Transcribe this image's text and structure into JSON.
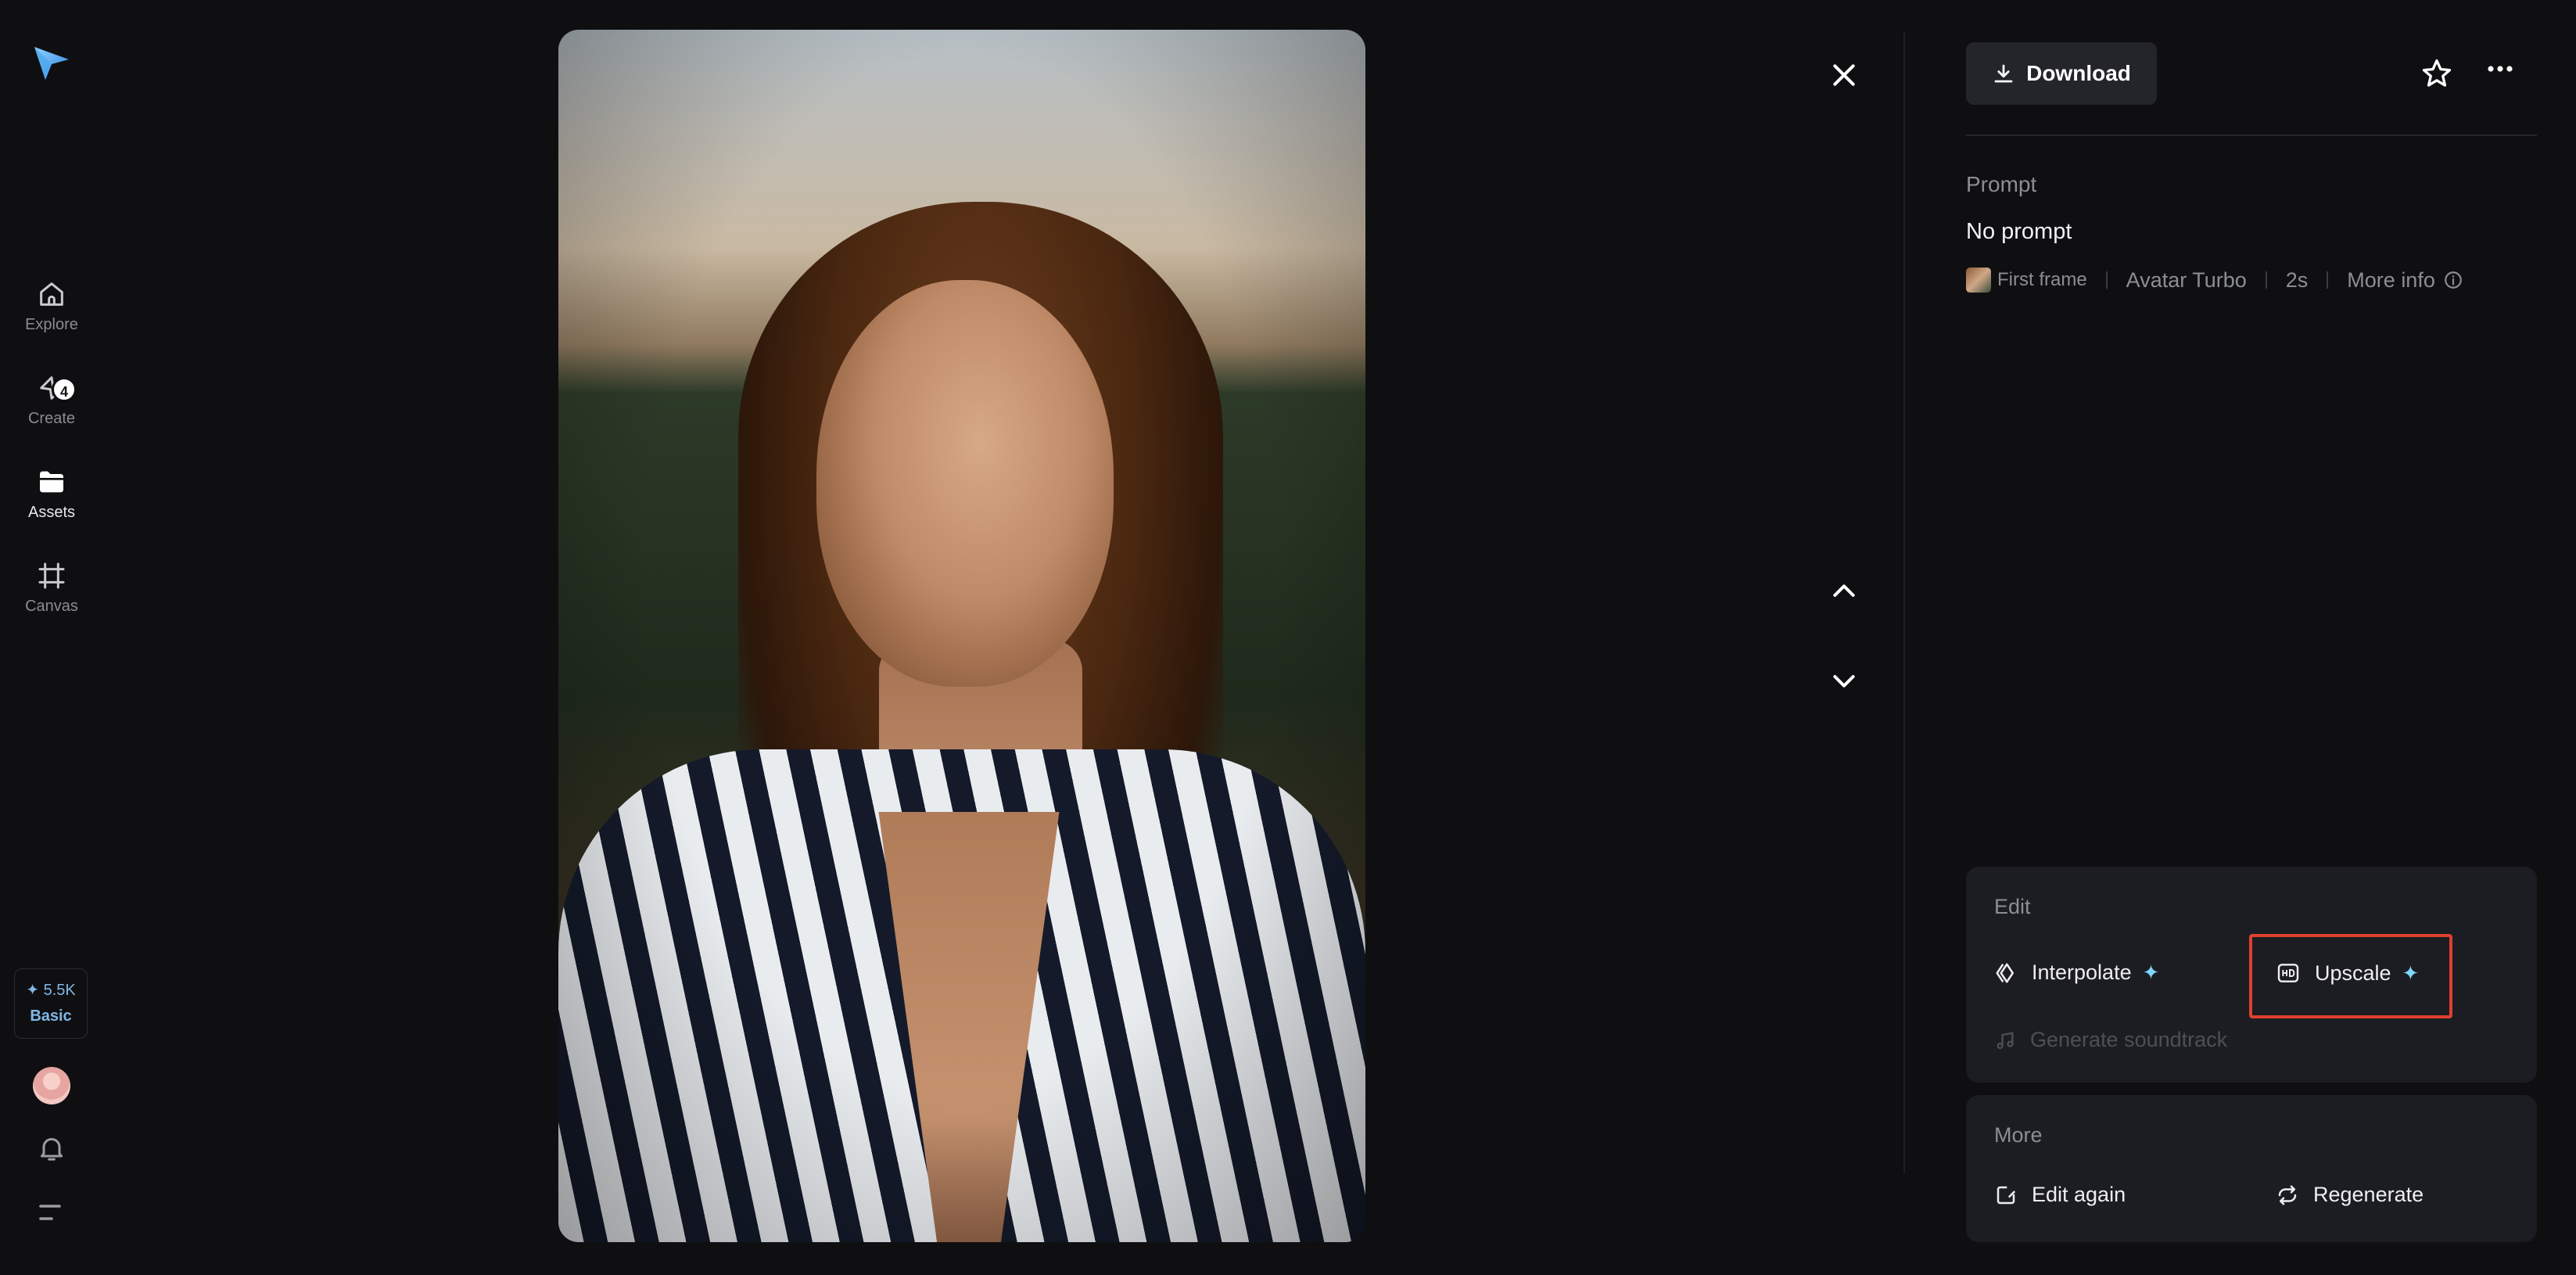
{
  "sidebar": {
    "items": [
      {
        "label": "Explore",
        "icon": "home-icon"
      },
      {
        "label": "Create",
        "icon": "create-icon",
        "badge": "4"
      },
      {
        "label": "Assets",
        "icon": "folder-icon"
      },
      {
        "label": "Canvas",
        "icon": "canvas-icon"
      }
    ],
    "credits": {
      "amount": "✦ 5.5K",
      "plan": "Basic"
    }
  },
  "panel": {
    "download_label": "Download",
    "prompt_label": "Prompt",
    "prompt_text": "No prompt",
    "meta": {
      "frame": "First frame",
      "model": "Avatar Turbo",
      "duration": "2s",
      "more_info": "More info"
    },
    "edit": {
      "title": "Edit",
      "interpolate": "Interpolate",
      "upscale": "Upscale",
      "soundtrack": "Generate soundtrack"
    },
    "more": {
      "title": "More",
      "edit_again": "Edit again",
      "regenerate": "Regenerate"
    }
  },
  "colors": {
    "background": "#0f0f12",
    "card": "#1c1d22",
    "accent_sparkle": "#7fd6ff",
    "highlight": "#e0402f"
  }
}
